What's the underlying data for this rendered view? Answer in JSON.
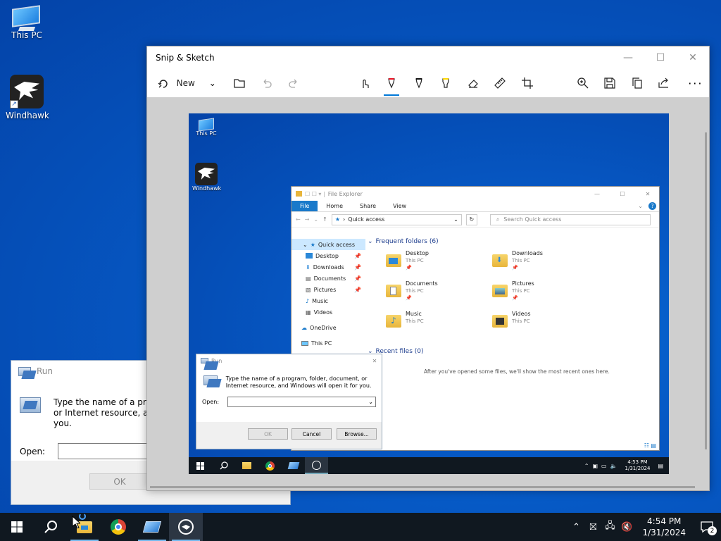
{
  "desktop": {
    "icons": [
      {
        "label": "This PC",
        "icon": "this-pc-icon"
      },
      {
        "label": "Windhawk",
        "icon": "windhawk-icon"
      }
    ]
  },
  "bg_run": {
    "title": "Run",
    "message": "Type the name of a program, folder, document, or Internet resource, and Windows will open it for you.",
    "open_label": "Open:",
    "ok_label": "OK"
  },
  "snip": {
    "title": "Snip & Sketch",
    "new_label": "New",
    "toolbar_icons": [
      "undo-icon",
      "redo-icon",
      "touch-writing-icon",
      "ballpoint-pen-icon",
      "pencil-icon",
      "highlighter-icon",
      "eraser-icon",
      "ruler-icon",
      "crop-icon",
      "zoom-icon",
      "save-icon",
      "copy-icon",
      "share-icon",
      "more-icon"
    ]
  },
  "shot": {
    "desk_icons": [
      {
        "label": "This PC"
      },
      {
        "label": "Windhawk"
      }
    ],
    "explorer": {
      "title": "File Explorer",
      "tabs": [
        "File",
        "Home",
        "Share",
        "View"
      ],
      "address": "Quick access",
      "search_placeholder": "Search Quick access",
      "nav": [
        {
          "label": "Quick access",
          "pin": ""
        },
        {
          "label": "Desktop",
          "pin": "📌"
        },
        {
          "label": "Downloads",
          "pin": "📌"
        },
        {
          "label": "Documents",
          "pin": "📌"
        },
        {
          "label": "Pictures",
          "pin": "📌"
        },
        {
          "label": "Music",
          "pin": ""
        },
        {
          "label": "Videos",
          "pin": ""
        },
        {
          "label": "OneDrive",
          "pin": ""
        },
        {
          "label": "This PC",
          "pin": ""
        }
      ],
      "frequent_header": "Frequent folders (6)",
      "folders": [
        {
          "name": "Desktop",
          "sub": "This PC"
        },
        {
          "name": "Downloads",
          "sub": "This PC"
        },
        {
          "name": "Documents",
          "sub": "This PC"
        },
        {
          "name": "Pictures",
          "sub": "This PC"
        },
        {
          "name": "Music",
          "sub": "This PC"
        },
        {
          "name": "Videos",
          "sub": "This PC"
        }
      ],
      "recent_header": "Recent files (0)",
      "recent_empty": "After you've opened some files, we'll show the most recent ones here."
    },
    "run": {
      "title": "Run",
      "message": "Type the name of a program, folder, document, or Internet resource, and Windows will open it for you.",
      "open_label": "Open:",
      "ok": "OK",
      "cancel": "Cancel",
      "browse": "Browse..."
    },
    "clock_time": "4:53 PM",
    "clock_date": "1/31/2024"
  },
  "taskbar": {
    "clock_time": "4:54 PM",
    "clock_date": "1/31/2024",
    "notification_count": "2"
  }
}
